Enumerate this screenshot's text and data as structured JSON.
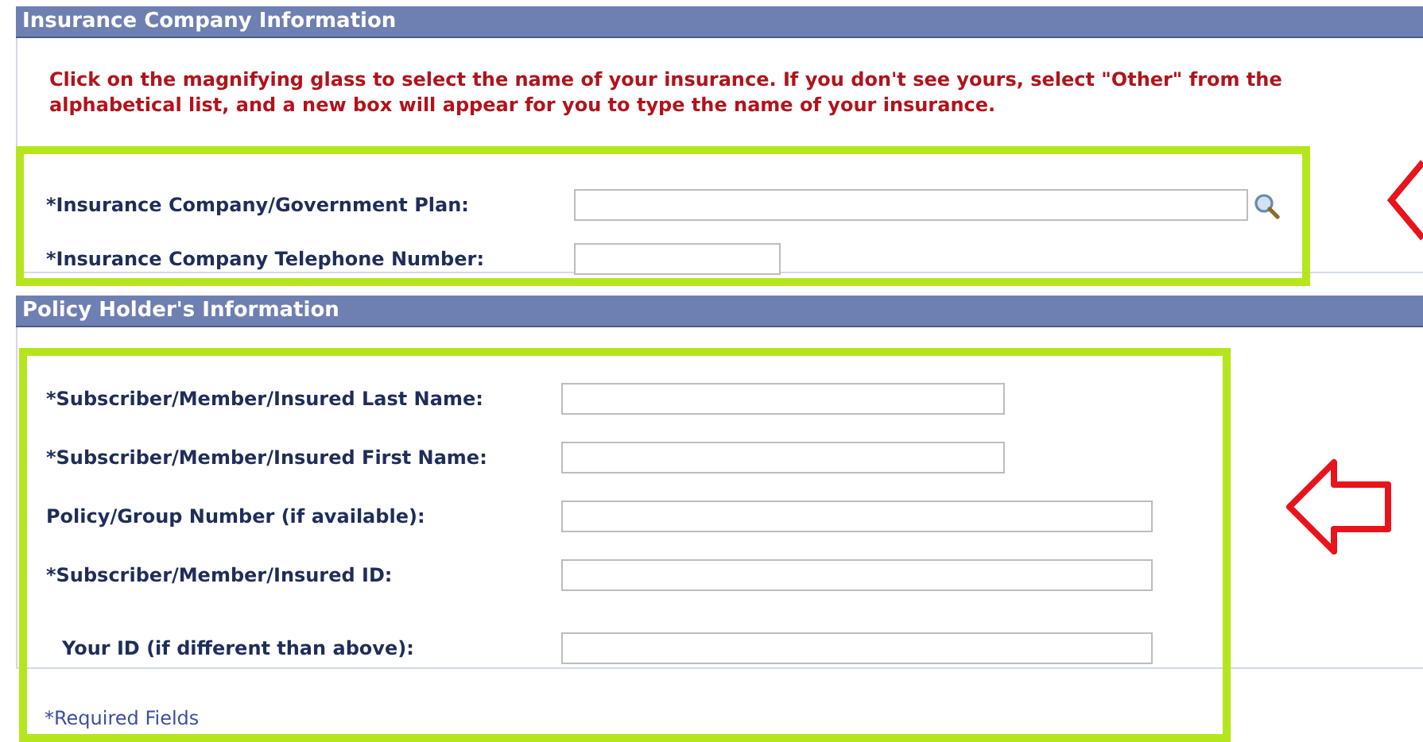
{
  "sections": [
    {
      "title": "Insurance Company Information",
      "instructions": "Click on the magnifying glass to select the name of your insurance. If you don't see yours, select \"Other\" from the alphabetical list, and a new box will appear for you to type the name of your insurance.",
      "fields": [
        {
          "label": "*Insurance Company/Government Plan:",
          "kind": "lookup",
          "indented": false
        },
        {
          "label": "*Insurance Company Telephone Number:",
          "kind": "short",
          "indented": false
        }
      ]
    },
    {
      "title": "Policy Holder's Information",
      "fields": [
        {
          "label": "*Subscriber/Member/Insured Last Name:",
          "kind": "medium",
          "indented": false
        },
        {
          "label": "*Subscriber/Member/Insured First Name:",
          "kind": "medium",
          "indented": false
        },
        {
          "label": "Policy/Group Number (if available):",
          "kind": "long",
          "indented": false
        },
        {
          "label": "*Subscriber/Member/Insured ID:",
          "kind": "long",
          "indented": false
        },
        {
          "label": "Your ID (if different than above):",
          "kind": "long",
          "indented": true
        }
      ],
      "footnote": "*Required Fields"
    }
  ]
}
